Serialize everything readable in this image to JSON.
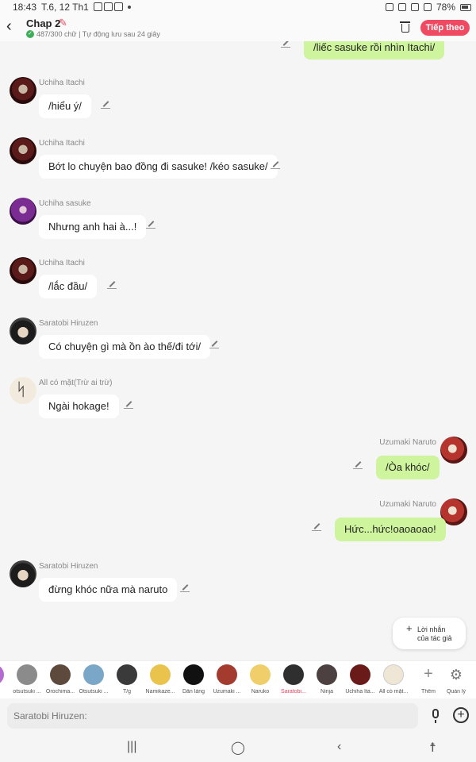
{
  "status_bar": {
    "time": "18:43",
    "date": "T.6, 12 Th1",
    "battery": "78%"
  },
  "header": {
    "title": "Chap 2",
    "autosave": "487/300 chữ | Tự động lưu sau 24 giây",
    "next_button": "Tiếp theo"
  },
  "messages": [
    {
      "side": "right",
      "sender": "",
      "avatar": "",
      "text": "/liếc sasuke rồi nhìn Itachi/"
    },
    {
      "side": "left",
      "sender": "Uchiha Itachi",
      "avatar": "itachi",
      "text": "/hiểu ý/"
    },
    {
      "side": "left",
      "sender": "Uchiha Itachi",
      "avatar": "itachi",
      "text": "Bớt lo chuyện bao đồng đi sasuke! /kéo sasuke/"
    },
    {
      "side": "left",
      "sender": "Uchiha sasuke",
      "avatar": "sasuke",
      "text": "Nhưng anh hai à...!"
    },
    {
      "side": "left",
      "sender": "Uchiha Itachi",
      "avatar": "itachi",
      "text": "/lắc đầu/"
    },
    {
      "side": "left",
      "sender": "Saratobi Hiruzen",
      "avatar": "hiruzen",
      "text": "Có chuyện gì mà ồn ào thế/đi tới/"
    },
    {
      "side": "left",
      "sender": "All có mặt(Trừ ai trừ)",
      "avatar": "all",
      "text": "Ngài hokage!"
    },
    {
      "side": "right",
      "sender": "Uzumaki Naruto",
      "avatar": "naruto",
      "text": "/Òa khóc/"
    },
    {
      "side": "right",
      "sender": "Uzumaki Naruto",
      "avatar": "naruto",
      "text": "Hức...hức!oaoaoao!"
    },
    {
      "side": "left",
      "sender": "Saratobi Hiruzen",
      "avatar": "hiruzen",
      "text": "đừng khóc nữa mà naruto"
    }
  ],
  "tip_card": {
    "line1": "Lời nhắn",
    "line2": "của tác giả"
  },
  "characters": [
    {
      "name": "otsutsuki ...",
      "color": "#8b8b8b"
    },
    {
      "name": "Orochima...",
      "color": "#5d4a3d"
    },
    {
      "name": "Otsutsuki ...",
      "color": "#7aa7c7"
    },
    {
      "name": "T/g",
      "color": "#3a3a3a"
    },
    {
      "name": "Namikaze...",
      "color": "#e9c34b"
    },
    {
      "name": "Dân làng",
      "color": "#111111"
    },
    {
      "name": "Uzumaki ...",
      "color": "#a33b2e"
    },
    {
      "name": "Naruko",
      "color": "#f0cf6b"
    },
    {
      "name": "Saratobi...",
      "color": "#2f2f2f",
      "active": true
    },
    {
      "name": "Ninja",
      "color": "#4c4040"
    },
    {
      "name": "Uchiha Ita...",
      "color": "#6b1a1a"
    },
    {
      "name": "All có mặt...",
      "color": "#efe6d5"
    }
  ],
  "char_actions": {
    "add": "Thêm",
    "manage": "Quản lý"
  },
  "input": {
    "placeholder": "Saratobi Hiruzen:"
  },
  "colors": {
    "accent": "#f04a63",
    "bubble_right": "#cef49d",
    "bubble_left": "#ffffff"
  }
}
